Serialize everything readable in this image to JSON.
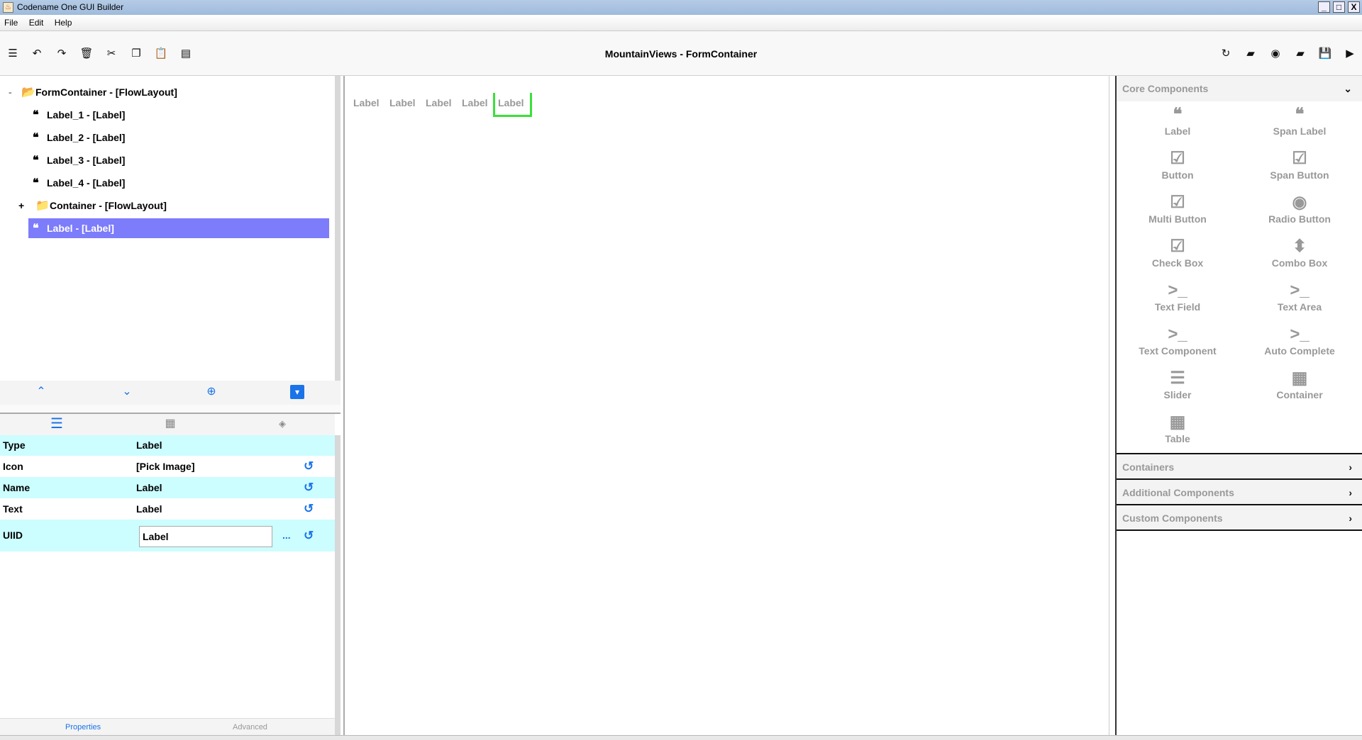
{
  "window": {
    "title": "Codename One GUI Builder",
    "min": "_",
    "max": "□",
    "close": "X"
  },
  "menu": [
    "File",
    "Edit",
    "Help"
  ],
  "toolbar": {
    "title": "MountainViews - FormContainer"
  },
  "tree": [
    {
      "label": "FormContainer - [FlowLayout]",
      "toggle": "-"
    },
    {
      "label": "Label_1 - [Label]"
    },
    {
      "label": "Label_2 - [Label]"
    },
    {
      "label": "Label_3 - [Label]"
    },
    {
      "label": "Label_4 - [Label]"
    },
    {
      "label": "Container - [FlowLayout]",
      "toggle": "+"
    },
    {
      "label": "Label - [Label]",
      "selected": true
    }
  ],
  "properties": [
    {
      "key": "Type",
      "value": "Label"
    },
    {
      "key": "Icon",
      "value": "[Pick Image]"
    },
    {
      "key": "Name",
      "value": "Label"
    },
    {
      "key": "Text",
      "value": "Label"
    },
    {
      "key": "UIID",
      "value": "Label",
      "more": "..."
    }
  ],
  "bottom_tabs": [
    "Properties",
    "Advanced"
  ],
  "canvas": {
    "labels": [
      "Label",
      "Label",
      "Label",
      "Label",
      "Label"
    ]
  },
  "palette": {
    "core": "Core Components",
    "items": [
      "Label",
      "Span Label",
      "Button",
      "Span Button",
      "Multi Button",
      "Radio Button",
      "Check Box",
      "Combo Box",
      "Text Field",
      "Text Area",
      "Text Component",
      "Auto Complete",
      "Slider",
      "Container",
      "Table"
    ],
    "sections": [
      "Containers",
      "Additional Components",
      "Custom Components"
    ]
  },
  "colors": {
    "selection": "#7d7cfb",
    "accent": "#1a73e8",
    "property_row": "#ccfdff",
    "selected_outline": "#3ae03a"
  }
}
